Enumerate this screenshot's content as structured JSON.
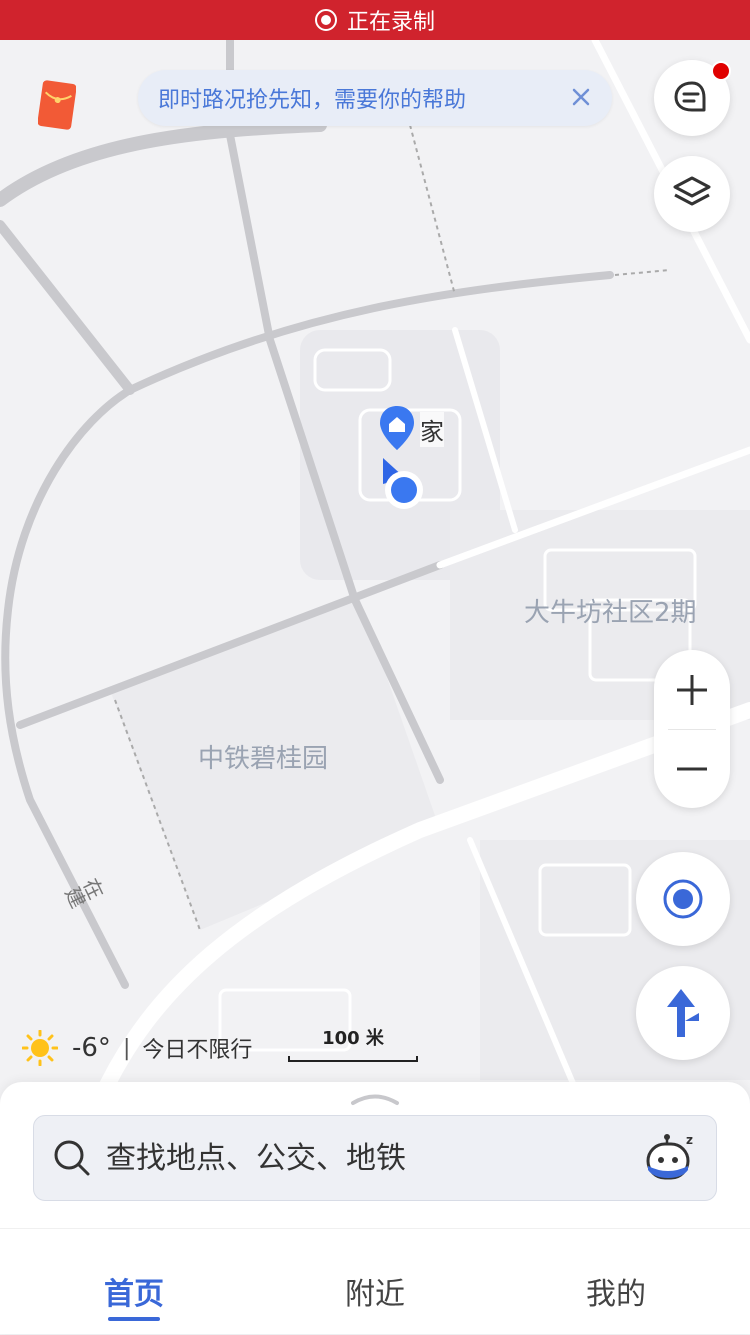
{
  "status_bar": {
    "recording_label": "正在录制"
  },
  "banner": {
    "text": "即时路况抢先知，需要你的帮助"
  },
  "map": {
    "places": [
      {
        "name": "家"
      },
      {
        "name": "大牛坊社区2期"
      },
      {
        "name": "中铁碧桂园"
      },
      {
        "name": "在建"
      }
    ],
    "controls": {
      "zoom_in": "+",
      "zoom_out": "—"
    }
  },
  "weather": {
    "temperature": "-6°",
    "separator": "|",
    "restriction": "今日不限行"
  },
  "scale": {
    "label": "100 米"
  },
  "search": {
    "placeholder": "查找地点、公交、地铁",
    "value": ""
  },
  "tabs": [
    {
      "label": "首页",
      "active": true
    },
    {
      "label": "附近",
      "active": false
    },
    {
      "label": "我的",
      "active": false
    }
  ],
  "colors": {
    "accent": "#3a68d8",
    "record_bar": "#d0232d",
    "notification_dot": "#e00000"
  }
}
